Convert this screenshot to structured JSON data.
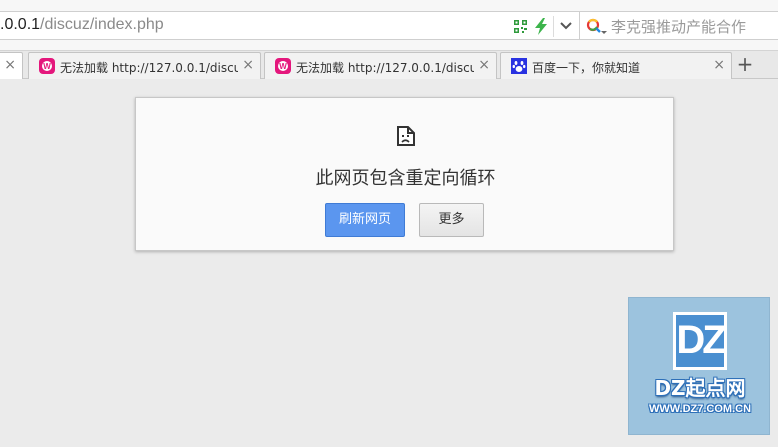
{
  "address_bar": {
    "url_host": ".0.0.1",
    "url_path": "/discuz/index.php",
    "search_hint": "李克强推动产能合作"
  },
  "tabs": [
    {
      "title": "",
      "icon": "page-icon",
      "close": "×",
      "active": true
    },
    {
      "title": "无法加载 http://127.0.0.1/discuz",
      "icon": "w-logo-icon",
      "close": "×",
      "active": false
    },
    {
      "title": "无法加载 http://127.0.0.1/discuz",
      "icon": "w-logo-icon",
      "close": "×",
      "active": false
    },
    {
      "title": "百度一下，你就知道",
      "icon": "baidu-paw-icon",
      "close": "×",
      "active": false
    }
  ],
  "new_tab_label": "+",
  "error": {
    "title": "此网页包含重定向循环",
    "reload_label": "刷新网页",
    "more_label": "更多"
  },
  "watermark": {
    "mark": "DZ",
    "name": "DZ起点网",
    "url": "WWW.DZ7.COM.CN"
  },
  "colors": {
    "accent_button": "#5b96ef",
    "watermark_bg": "#9cc3de",
    "w_logo": "#e4177c",
    "baidu": "#2932e1",
    "bolt": "#3cb44b"
  }
}
